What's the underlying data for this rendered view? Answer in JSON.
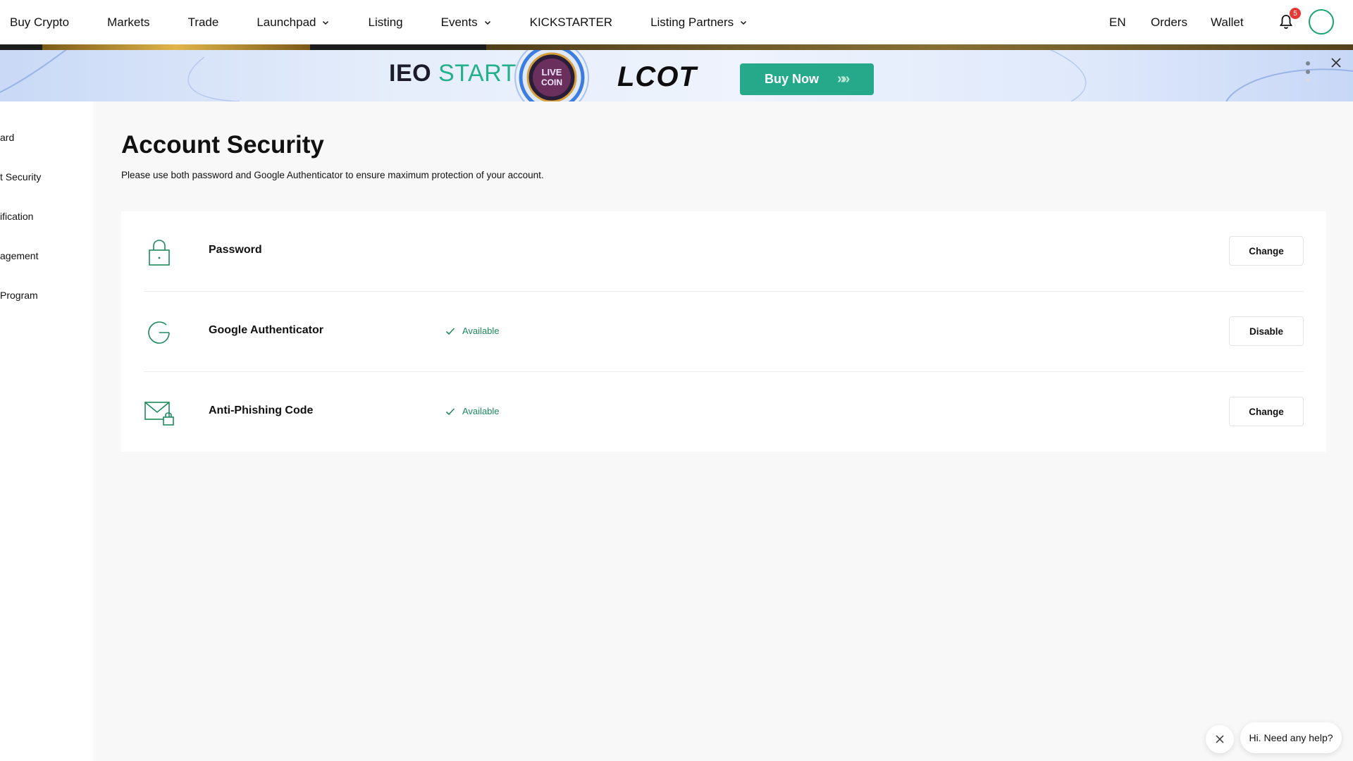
{
  "nav": {
    "items": [
      {
        "label": "Buy Crypto",
        "dropdown": false
      },
      {
        "label": "Markets",
        "dropdown": false
      },
      {
        "label": "Trade",
        "dropdown": false
      },
      {
        "label": "Launchpad",
        "dropdown": true
      },
      {
        "label": "Listing",
        "dropdown": false
      },
      {
        "label": "Events",
        "dropdown": true
      },
      {
        "label": "KICKSTARTER",
        "dropdown": false
      },
      {
        "label": "Listing Partners",
        "dropdown": true
      }
    ],
    "language": "EN",
    "orders": "Orders",
    "wallet": "Wallet",
    "notification_count": "5"
  },
  "banner": {
    "ieo": "IEO",
    "start": "START",
    "coin_logo_text": [
      "LIVE",
      "COIN"
    ],
    "coin_name": "LCOT",
    "buy_label": "Buy Now",
    "buy_arrows": "»»"
  },
  "sidebar": {
    "items": [
      {
        "label": "ard"
      },
      {
        "label": "t Security"
      },
      {
        "label": "ification"
      },
      {
        "label": "agement"
      },
      {
        "label": " Program"
      }
    ]
  },
  "page": {
    "title": "Account Security",
    "description": "Please use both password and Google Authenticator to ensure maximum protection of your account."
  },
  "security": {
    "rows": [
      {
        "label": "Password",
        "status": "",
        "button": "Change",
        "icon": "lock-icon"
      },
      {
        "label": "Google Authenticator",
        "status": "Available",
        "button": "Disable",
        "icon": "google-authenticator-icon"
      },
      {
        "label": "Anti-Phishing Code",
        "status": "Available",
        "button": "Change",
        "icon": "mail-lock-icon"
      }
    ]
  },
  "chat": {
    "prompt": "Hi. Need any help?"
  },
  "colors": {
    "accent": "#26a98a",
    "status_green": "#1d8a5d",
    "badge_red": "#e53935"
  }
}
